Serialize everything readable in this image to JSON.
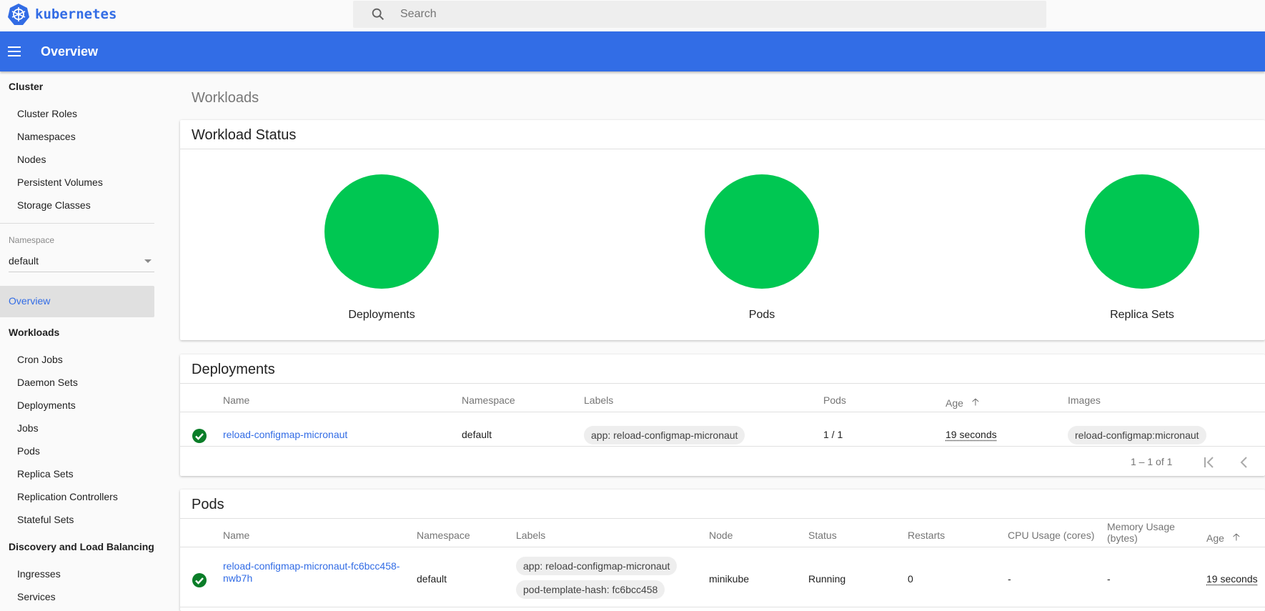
{
  "app": {
    "logo_text": "kubernetes",
    "brand_color": "#326ce5",
    "search_placeholder": "Search"
  },
  "appbar": {
    "title": "Overview"
  },
  "sidebar": {
    "cluster": {
      "heading": "Cluster",
      "items": [
        "Cluster Roles",
        "Namespaces",
        "Nodes",
        "Persistent Volumes",
        "Storage Classes"
      ]
    },
    "namespace": {
      "label": "Namespace",
      "value": "default"
    },
    "overview_label": "Overview",
    "workloads": {
      "heading": "Workloads",
      "items": [
        "Cron Jobs",
        "Daemon Sets",
        "Deployments",
        "Jobs",
        "Pods",
        "Replica Sets",
        "Replication Controllers",
        "Stateful Sets"
      ]
    },
    "discovery": {
      "heading": "Discovery and Load Balancing",
      "items": [
        "Ingresses",
        "Services"
      ]
    }
  },
  "main": {
    "heading": "Workloads",
    "workload_status": {
      "title": "Workload Status",
      "status_color": "#00c752",
      "items": [
        {
          "label": "Deployments",
          "running_fraction": 1.0
        },
        {
          "label": "Pods",
          "running_fraction": 1.0
        },
        {
          "label": "Replica Sets",
          "running_fraction": 1.0
        }
      ]
    },
    "deployments": {
      "title": "Deployments",
      "columns": [
        "Name",
        "Namespace",
        "Labels",
        "Pods",
        "Age",
        "Images"
      ],
      "sort_icon": "arrow-up",
      "rows": [
        {
          "status": "check-circle",
          "name": "reload-configmap-micronaut",
          "namespace": "default",
          "labels": [
            "app: reload-configmap-micronaut"
          ],
          "pods": "1 / 1",
          "age": "19 seconds",
          "images": [
            "reload-configmap:micronaut"
          ]
        }
      ],
      "pagination": "1 – 1 of 1"
    },
    "pods": {
      "title": "Pods",
      "columns": [
        "Name",
        "Namespace",
        "Labels",
        "Node",
        "Status",
        "Restarts",
        "CPU Usage (cores)",
        "Memory Usage (bytes)",
        "Age"
      ],
      "rows": [
        {
          "status_icon": "check-circle",
          "name": "reload-configmap-micronaut-fc6bcc458-nwb7h",
          "name_line1": "reload-configmap-micronaut-fc6bcc458-",
          "name_line2": "nwb7h",
          "namespace": "default",
          "labels": [
            "app: reload-configmap-micronaut",
            "pod-template-hash: fc6bcc458"
          ],
          "node": "minikube",
          "status": "Running",
          "restarts": "0",
          "cpu": "-",
          "memory": "-",
          "age": "19 seconds"
        }
      ]
    }
  }
}
